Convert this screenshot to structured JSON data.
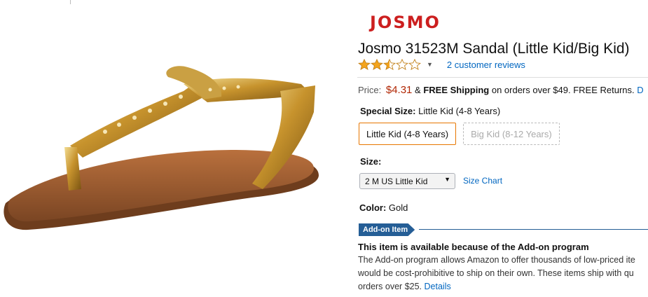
{
  "brand": {
    "logo_text": "JOSMO"
  },
  "product": {
    "title": "Josmo 31523M Sandal (Little Kid/Big Kid)",
    "rating": {
      "stars": 2.5,
      "max": 5,
      "reviews_link": "2 customer reviews"
    }
  },
  "price": {
    "label": "Price:",
    "value": "$4.31",
    "amp": "&",
    "free_shipping": "FREE Shipping",
    "shipping_text": "on orders over $49.",
    "returns_text": "FREE Returns.",
    "details_fragment": "D"
  },
  "special_size": {
    "label": "Special Size:",
    "value": "Little Kid (4-8 Years)",
    "options": [
      {
        "label": "Little Kid (4-8 Years)",
        "selected": true
      },
      {
        "label": "Big Kid (8-12 Years)",
        "selected": false
      }
    ]
  },
  "size": {
    "label": "Size:",
    "selected": "2 M US Little Kid",
    "chart_link": "Size Chart"
  },
  "color": {
    "label": "Color:",
    "value": "Gold"
  },
  "addon": {
    "badge": "Add-on Item",
    "heading": "This item is available because of the Add-on program",
    "line1": "The Add-on program allows Amazon to offer thousands of low-priced ite",
    "line2": "would be cost-prohibitive to ship on their own. These items ship with qu",
    "line3": "orders over $25.",
    "details_link": "Details"
  },
  "colors": {
    "price": "#b12704",
    "link": "#0066c0",
    "brand": "#cc1f1f",
    "addon": "#255e96",
    "star": "#f4a41c"
  }
}
